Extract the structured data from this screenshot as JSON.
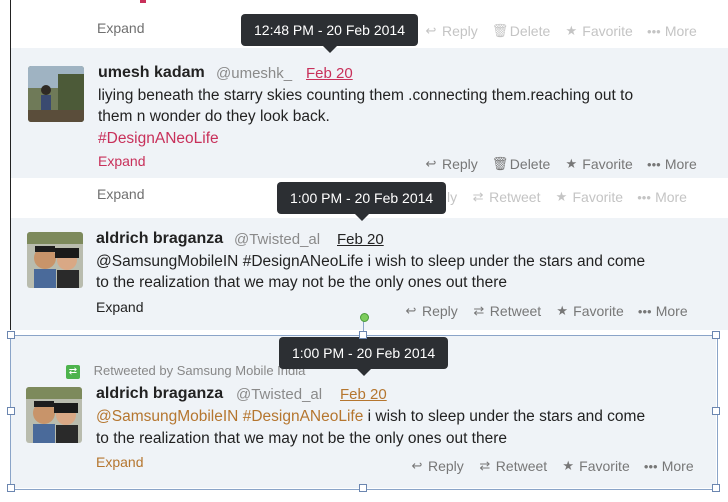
{
  "panel1": {
    "top_expand": "Expand",
    "top_actions": {
      "reply": "Reply",
      "delete": "Delete",
      "favorite": "Favorite",
      "more": "More"
    },
    "tooltip": "12:48 PM - 20 Feb 2014",
    "tweet": {
      "name": "umesh kadam",
      "handle": "@umeshk_",
      "date": "Feb 20",
      "text_line1": "liying beneath the starry skies counting them .connecting them.reaching out to",
      "text_line2": "them n wonder do they look back.",
      "hashtag": "#DesignANeoLife",
      "expand": "Expand",
      "actions": {
        "reply": "Reply",
        "delete": "Delete",
        "favorite": "Favorite",
        "more": "More"
      }
    }
  },
  "panel2": {
    "top_expand": "Expand",
    "top_actions": {
      "reply": "ly",
      "retweet": "Retweet",
      "favorite": "Favorite",
      "more": "More"
    },
    "tooltip": "1:00 PM - 20 Feb 2014",
    "tweet": {
      "name": "aldrich braganza",
      "handle": "@Twisted_al",
      "date": "Feb 20",
      "mention": "@SamsungMobileIN",
      "hashtag": "#DesignANeoLife",
      "text_rest": " i wish to sleep under the stars and  come",
      "text_line2": "to the realization that we may not be the only ones out there",
      "expand": "Expand",
      "actions": {
        "reply": "Reply",
        "retweet": "Retweet",
        "favorite": "Favorite",
        "more": "More"
      }
    }
  },
  "panel3": {
    "retweeted_by": "Retweeted by Samsung Mobile India",
    "tooltip": "1:00 PM - 20 Feb 2014",
    "tweet": {
      "name": "aldrich braganza",
      "handle": "@Twisted_al",
      "date": "Feb 20",
      "mention": "@SamsungMobileIN",
      "hashtag": "#DesignANeoLife",
      "text_rest": " i wish to sleep under the stars and  come",
      "text_line2": "to the realization that we may not be the only ones out there",
      "expand": "Expand",
      "actions": {
        "reply": "Reply",
        "retweet": "Retweet",
        "favorite": "Favorite",
        "more": "More"
      }
    }
  },
  "colors": {
    "hashtag_red": "#c8305a",
    "hashtag_orange": "#b5762f",
    "tooltip_bg": "#2c2f33",
    "tweet_bg": "#eff3f7",
    "retweet_green": "#4db34d"
  },
  "icons": {
    "reply": "reply-icon",
    "delete": "trash-icon",
    "favorite": "star-icon",
    "more": "ellipsis-icon",
    "retweet": "retweet-icon"
  }
}
